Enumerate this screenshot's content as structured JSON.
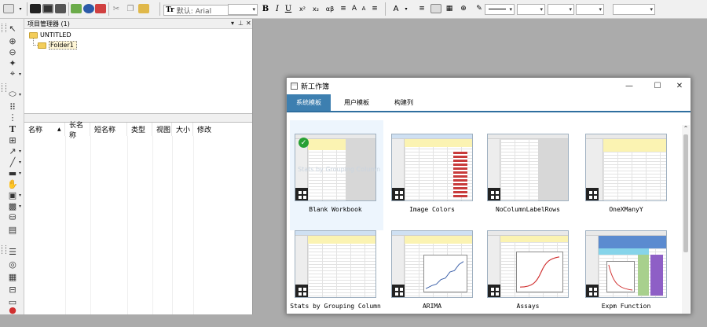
{
  "toolbar": {
    "font_name": "默认: Arial",
    "bold": "B",
    "italic": "I",
    "underline": "U",
    "superscript": "x²",
    "subscript": "x₂",
    "greek": "αβ",
    "icons": [
      "new-project-icon",
      "open-icon",
      "save-icon",
      "import-icon",
      "new-workbook-icon",
      "new-graph-icon",
      "new-matrix-icon",
      "paste-icon",
      "text-tool-icon",
      "align-left-icon",
      "font-color-icon",
      "fill-color-icon",
      "line-style-icon"
    ]
  },
  "left_tools": {
    "icons": [
      "pointer-icon",
      "zoom-in-icon",
      "zoom-out-icon",
      "data-reader-icon",
      "screen-reader-icon",
      "mask-icon",
      "text-tool-icon",
      "arrow-tool-icon",
      "line-tool-icon",
      "rectangle-tool-icon",
      "hand-icon",
      "region-icon",
      "layer-icon",
      "lock-icon",
      "record-icon"
    ],
    "text_tool": "T"
  },
  "explorer": {
    "title": "项目管理器 (1)",
    "root": "UNTITLED",
    "folder": "Folder1",
    "columns": [
      "名称",
      "长名称",
      "短名称",
      "类型",
      "视图",
      "大小",
      "修改"
    ]
  },
  "dialog": {
    "title": "新工作簿",
    "tabs": [
      "系统模板",
      "用户模板",
      "构建列"
    ],
    "active_tab": 0,
    "templates": [
      {
        "name": "Blank Workbook",
        "selected": true
      },
      {
        "name": "Image Colors"
      },
      {
        "name": "NoColumnLabelRows"
      },
      {
        "name": "OneXManyY"
      },
      {
        "name": "Stats by Grouping Column"
      },
      {
        "name": "ARIMA"
      },
      {
        "name": "Assays"
      },
      {
        "name": "Expm Function"
      }
    ],
    "thumb_headers": [
      "A(X)",
      "B(Y)",
      "C(Y)",
      "D(Y)"
    ],
    "row_labels": [
      "Long Name",
      "Units",
      "Comments",
      "F(x)="
    ],
    "ghost_caption": "Stats by Grouping Column"
  },
  "colors": {
    "tab_active": "#3d7fb0",
    "tab_underline": "#2f6f9f",
    "check": "#28a033",
    "folder": "#f3cd5a"
  }
}
